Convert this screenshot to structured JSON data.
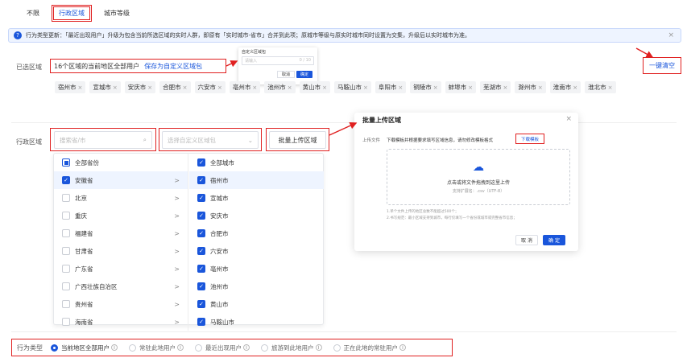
{
  "tabs": [
    {
      "label": "不限"
    },
    {
      "label": "行政区域"
    },
    {
      "label": "城市等级"
    }
  ],
  "notice": {
    "text": "行为类型更新：「最近出现用户」升级为包含当前所选区域的实时人群，即原有「实时城市-省市」合并到此项；原城市等级与原实时城市同时设置为交集，升级后以实时城市为准。",
    "close": "×"
  },
  "selected": {
    "label": "已选区域",
    "summary": "16个区域的当前地区全部用户",
    "save_link": "保存为自定义区域包",
    "clear_all": "一键清空",
    "chips": [
      "宿州市",
      "宣城市",
      "安庆市",
      "合肥市",
      "六安市",
      "亳州市",
      "池州市",
      "黄山市",
      "马鞍山市",
      "阜阳市",
      "铜陵市",
      "蚌埠市",
      "芜湖市",
      "滁州市",
      "淮南市",
      "淮北市"
    ]
  },
  "custom_popup": {
    "title": "自定义区域包",
    "placeholder": "请输入",
    "count": "0 / 10",
    "cancel": "取消",
    "confirm": "确定"
  },
  "region": {
    "label": "行政区域",
    "search_placeholder": "搜索省/市",
    "select_placeholder": "选择自定义区域包",
    "batch_upload": "批量上传区域"
  },
  "provinces": [
    {
      "name": "全部省份",
      "state": "half"
    },
    {
      "name": "安徽省",
      "state": "on"
    },
    {
      "name": "北京",
      "state": "off"
    },
    {
      "name": "重庆",
      "state": "off"
    },
    {
      "name": "福建省",
      "state": "off"
    },
    {
      "name": "甘肃省",
      "state": "off"
    },
    {
      "name": "广东省",
      "state": "off"
    },
    {
      "name": "广西壮族自治区",
      "state": "off"
    },
    {
      "name": "贵州省",
      "state": "off"
    },
    {
      "name": "海南省",
      "state": "off"
    }
  ],
  "cities": [
    {
      "name": "全部城市"
    },
    {
      "name": "宿州市"
    },
    {
      "name": "宣城市"
    },
    {
      "name": "安庆市"
    },
    {
      "name": "合肥市"
    },
    {
      "name": "六安市"
    },
    {
      "name": "亳州市"
    },
    {
      "name": "池州市"
    },
    {
      "name": "黄山市"
    },
    {
      "name": "马鞍山市"
    }
  ],
  "dialog": {
    "title": "批量上传区域",
    "close": "×",
    "upload_label": "上传文件",
    "hint": "下载模板并根据要求填写区域信息，请勿修改模板格式",
    "download": "下载模板",
    "drop_text": "点击或将文件拖拽到这里上传",
    "ext_text": "支持扩展名：.csv（UTF-8）",
    "note1": "1.单个文件上传的地区总数不能超过500个；",
    "note2": "2.书写规范：最小区域支持到城市，每行仅填写一个省份或城市或完整省市信息；",
    "cancel": "取 消",
    "confirm": "确 定"
  },
  "behavior": {
    "label": "行为类型",
    "options": [
      {
        "label": "当前地区全部用户",
        "on": true
      },
      {
        "label": "常驻此地用户",
        "on": false
      },
      {
        "label": "最近出现用户",
        "on": false
      },
      {
        "label": "旅游到此地用户",
        "on": false
      },
      {
        "label": "正在此地的常驻用户",
        "on": false
      }
    ]
  },
  "colors": {
    "accent": "#1a56db",
    "annotation": "#e02020"
  }
}
